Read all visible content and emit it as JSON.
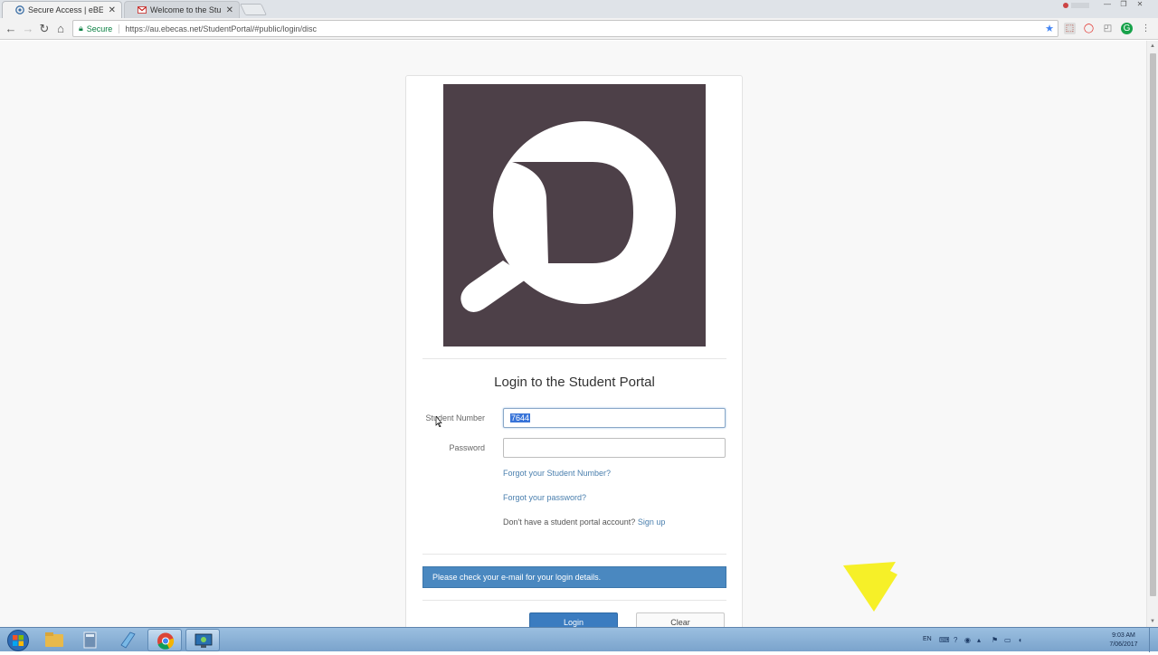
{
  "browser": {
    "tabs": [
      {
        "title": "Secure Access | eBECAS",
        "active": true
      },
      {
        "title": "Welcome to the Student",
        "active": false
      }
    ],
    "address": {
      "secure_label": "Secure",
      "url": "https://au.ebecas.net/StudentPortal/#public/login/disc"
    }
  },
  "login": {
    "heading": "Login to the Student Portal",
    "student_number_label": "Student Number",
    "student_number_value": "7644",
    "password_label": "Password",
    "password_value": "",
    "forgot_number_link": "Forgot your Student Number?",
    "forgot_password_link": "Forgot your password?",
    "signup_prompt": "Don't have a student portal account?",
    "signup_link": "Sign up",
    "notice": "Please check your e-mail for your login details.",
    "login_button": "Login",
    "clear_button": "Clear"
  },
  "taskbar": {
    "language": "EN",
    "time": "9:03 AM",
    "date": "7/06/2017"
  },
  "colors": {
    "logo_bg": "#4d4048",
    "notice_bg": "#4a88c0",
    "primary_button": "#3b7cc0",
    "link": "#4a7fae"
  }
}
